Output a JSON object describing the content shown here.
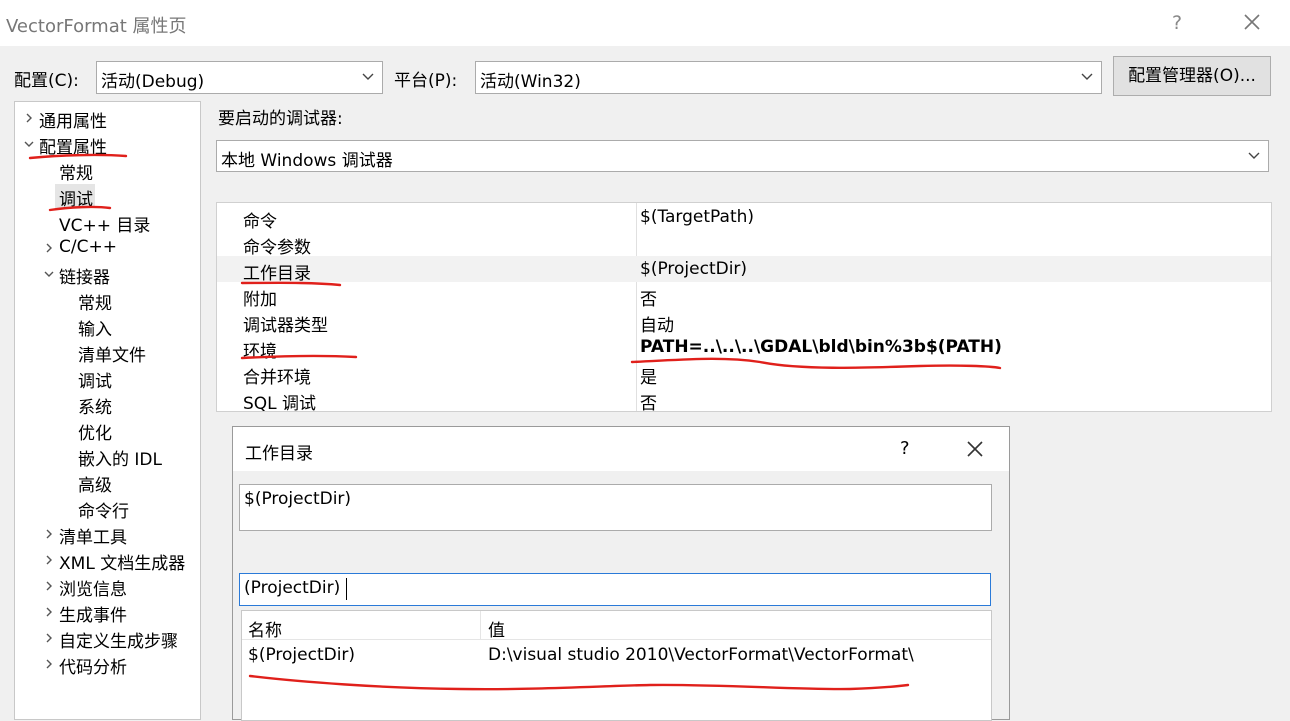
{
  "window": {
    "title": "VectorFormat 属性页",
    "help_glyph": "?"
  },
  "config": {
    "label": "配置(C):",
    "value": "活动(Debug)"
  },
  "platform": {
    "label": "平台(P):",
    "value": "活动(Win32)"
  },
  "config_manager_label": "配置管理器(O)...",
  "tree": {
    "items": [
      {
        "label": "通用属性",
        "expander": "collapsed"
      },
      {
        "label": "配置属性",
        "expander": "expanded"
      },
      {
        "label": "常规",
        "expander": "none"
      },
      {
        "label": "调试",
        "expander": "none",
        "selected": true
      },
      {
        "label": "VC++ 目录",
        "expander": "none"
      },
      {
        "label": "C/C++",
        "expander": "collapsed"
      },
      {
        "label": "链接器",
        "expander": "expanded"
      },
      {
        "label": "常规",
        "expander": "none"
      },
      {
        "label": "输入",
        "expander": "none"
      },
      {
        "label": "清单文件",
        "expander": "none"
      },
      {
        "label": "调试",
        "expander": "none"
      },
      {
        "label": "系统",
        "expander": "none"
      },
      {
        "label": "优化",
        "expander": "none"
      },
      {
        "label": "嵌入的 IDL",
        "expander": "none"
      },
      {
        "label": "高级",
        "expander": "none"
      },
      {
        "label": "命令行",
        "expander": "none"
      },
      {
        "label": "清单工具",
        "expander": "collapsed"
      },
      {
        "label": "XML 文档生成器",
        "expander": "collapsed"
      },
      {
        "label": "浏览信息",
        "expander": "collapsed"
      },
      {
        "label": "生成事件",
        "expander": "collapsed"
      },
      {
        "label": "自定义生成步骤",
        "expander": "collapsed"
      },
      {
        "label": "代码分析",
        "expander": "collapsed"
      }
    ]
  },
  "debugger": {
    "label": "要启动的调试器:",
    "value": "本地 Windows 调试器"
  },
  "properties": [
    {
      "name": "命令",
      "value": "$(TargetPath)"
    },
    {
      "name": "命令参数",
      "value": ""
    },
    {
      "name": "工作目录",
      "value": "$(ProjectDir)"
    },
    {
      "name": "附加",
      "value": "否"
    },
    {
      "name": "调试器类型",
      "value": "自动"
    },
    {
      "name": "环境",
      "value": "PATH=..\\..\\..\\GDAL\\bld\\bin%3b$(PATH)",
      "bold": true
    },
    {
      "name": "合并环境",
      "value": "是"
    },
    {
      "name": "SQL 调试",
      "value": "否"
    }
  ],
  "dialog": {
    "title": "工作目录",
    "help_glyph": "?",
    "preview_value": "$(ProjectDir)",
    "filter_value": "(ProjectDir)",
    "columns": [
      "名称",
      "值"
    ],
    "macros": [
      {
        "name": "$(ProjectDir)",
        "value": "D:\\visual studio 2010\\VectorFormat\\VectorFormat\\"
      }
    ]
  },
  "colors": {
    "annotation": "#e0201b",
    "selected_bg": "#e5e5e5",
    "row_highlight": "#f2f2f2"
  }
}
